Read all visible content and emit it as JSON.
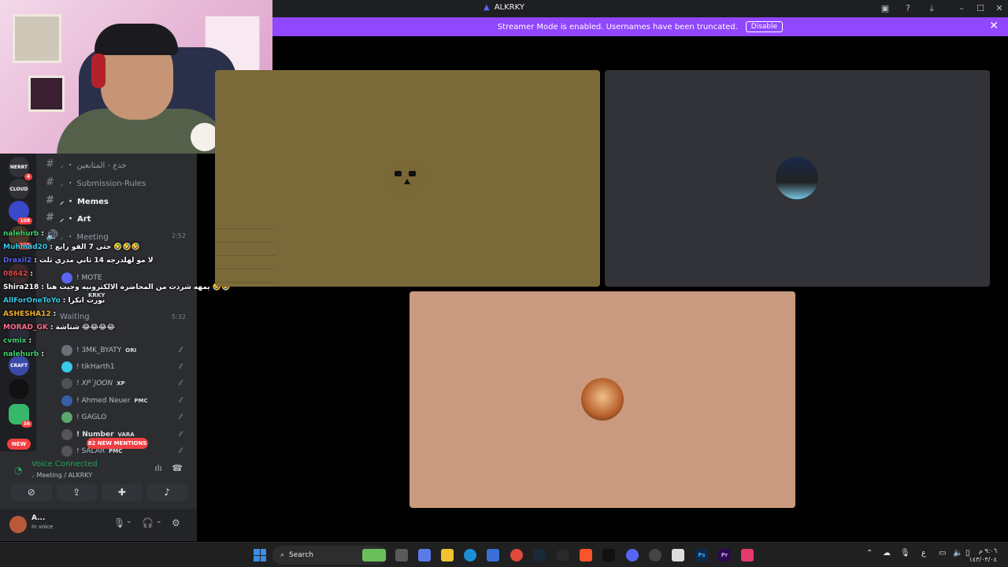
{
  "window": {
    "title": "ALKRKY"
  },
  "banner": {
    "message": "Streamer Mode is enabled. Usernames have been truncated.",
    "disable_label": "Disable"
  },
  "servers": [
    {
      "label": "NERRT",
      "badge": "4"
    },
    {
      "label": "CLOUD",
      "badge": ""
    },
    {
      "label": "",
      "badge": "108"
    },
    {
      "label": "",
      "badge": "207"
    },
    {
      "label": "",
      "badge": ""
    },
    {
      "label": "",
      "badge": ""
    },
    {
      "label": "CRAFT",
      "badge": ""
    },
    {
      "label": "",
      "badge": ""
    },
    {
      "label": "",
      "badge": "36"
    }
  ],
  "new_pill": "NEW",
  "channels": [
    {
      "name": "⸝ ・ خدع - المتابعين",
      "bold": false
    },
    {
      "name": "⸝ ・ Submission-Rules",
      "bold": false
    },
    {
      "name": "⸝ ・ Memes",
      "bold": true
    },
    {
      "name": "⸝ ・ Art",
      "bold": true
    },
    {
      "name": "⸝ ・ Meeting",
      "bold": false,
      "time": "2:52"
    },
    {
      "name": "Waiting",
      "bold": false,
      "time": "5:32"
    }
  ],
  "members": [
    {
      "name": "! MOTE",
      "tag": ""
    },
    {
      "name": "",
      "tag": "KRKY"
    },
    {
      "name": "! 3MK_BYATY",
      "tag": "ORI"
    },
    {
      "name": "! tikHarth1",
      "tag": ""
    },
    {
      "name": "! XP`JOON",
      "tag": "XP"
    },
    {
      "name": "! Ahmed Neuer",
      "tag": "PMC"
    },
    {
      "name": "! GAGLO",
      "tag": ""
    },
    {
      "name": "! Number",
      "tag": "VARA"
    },
    {
      "name": "! SALAR",
      "tag": "PMC"
    }
  ],
  "chat": [
    {
      "user": "nalehurb",
      "msg": ":",
      "color": "#3fd06b"
    },
    {
      "user": "Muhmad20",
      "msg": ": حتى 7 الفو رابع 🤣🤣🤣",
      "color": "#37c9e8"
    },
    {
      "user": "Draxil2",
      "msg": ": لا مو لهلدرجه 14 ثاني مدري ثلث",
      "color": "#5865f2"
    },
    {
      "user": "08642",
      "msg": ":",
      "color": "#e04848"
    },
    {
      "user": "Shira218",
      "msg": ": يمهه شردت من المحاضره الالكترونيه وجيت هنا 🤣🤣",
      "color": "#ffffff"
    },
    {
      "user": "AllForOneToYo",
      "msg": ": نورت انكرا",
      "color": "#37c9e8"
    },
    {
      "user": "ASHESHA12",
      "msg": ":",
      "color": "#f0b232"
    },
    {
      "user": "MORAD_GK",
      "msg": ": شتاشة 😂😂😂😂",
      "color": "#ff6e8a"
    },
    {
      "user": "cvmix",
      "msg": ":",
      "color": "#3fd06b"
    },
    {
      "user": "nalehurb",
      "msg": ":",
      "color": "#3fd06b"
    }
  ],
  "mentions_label": "82 NEW MENTIONS",
  "voice": {
    "status": "Voice Connected",
    "location": "⸝ Meeting / ALKRKY"
  },
  "user": {
    "name": "A...",
    "status": "In voice"
  },
  "taskbar": {
    "search_placeholder": "Search",
    "clock_time": "٩:٠٦ م",
    "clock_date": "١٤٣/٠٣/٠٤"
  },
  "colors": {
    "streamer_banner": "#9146ff",
    "voice_green": "#23a55a",
    "mention_red": "#f23f43"
  }
}
